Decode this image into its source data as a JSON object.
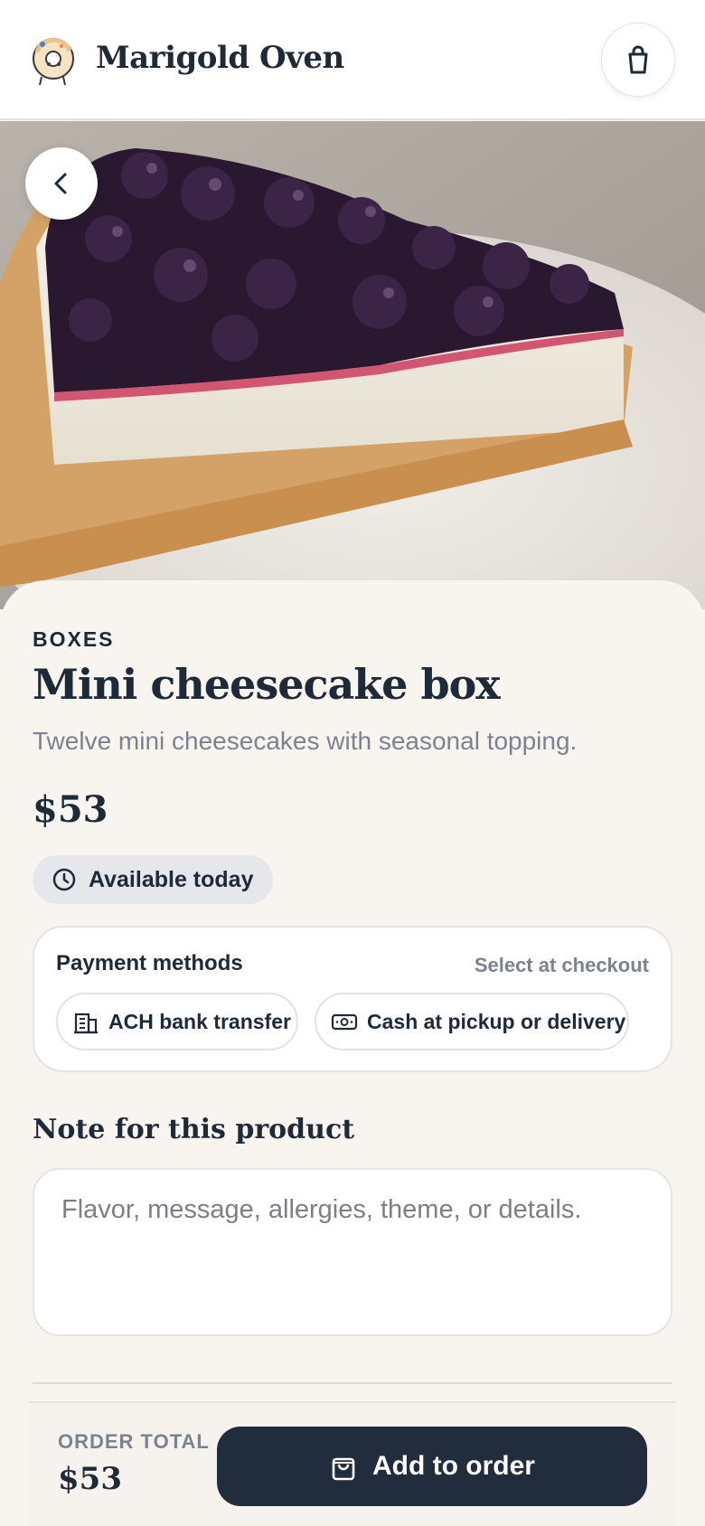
{
  "header": {
    "brand": "Marigold Oven",
    "logo_icon": "donut-mascot-icon",
    "cart_icon": "shopping-bag-icon"
  },
  "hero": {
    "image": "blueberry-cheesecake-slice",
    "back_icon": "chevron-left-icon"
  },
  "product": {
    "category": "BOXES",
    "title": "Mini cheesecake box",
    "description": "Twelve mini cheesecakes with seasonal topping.",
    "price": "$53",
    "availability": "Available today",
    "availability_icon": "clock-icon"
  },
  "payment": {
    "title": "Payment methods",
    "hint": "Select at checkout",
    "methods": [
      {
        "label": "ACH bank transfer",
        "icon": "bank-building-icon"
      },
      {
        "label": "Cash at pickup or delivery",
        "icon": "banknote-icon"
      }
    ]
  },
  "note": {
    "label": "Note for this product",
    "placeholder": "Flavor, message, allergies, theme, or details.",
    "value": ""
  },
  "footer": {
    "total_label": "ORDER TOTAL",
    "total_value": "$53",
    "button_label": "Add to order",
    "button_icon": "shopping-bag-icon"
  },
  "colors": {
    "primary": "#212d3d",
    "background": "#f8f5f1",
    "muted_text": "#7b8390",
    "chip_bg": "#e5e7ea"
  }
}
